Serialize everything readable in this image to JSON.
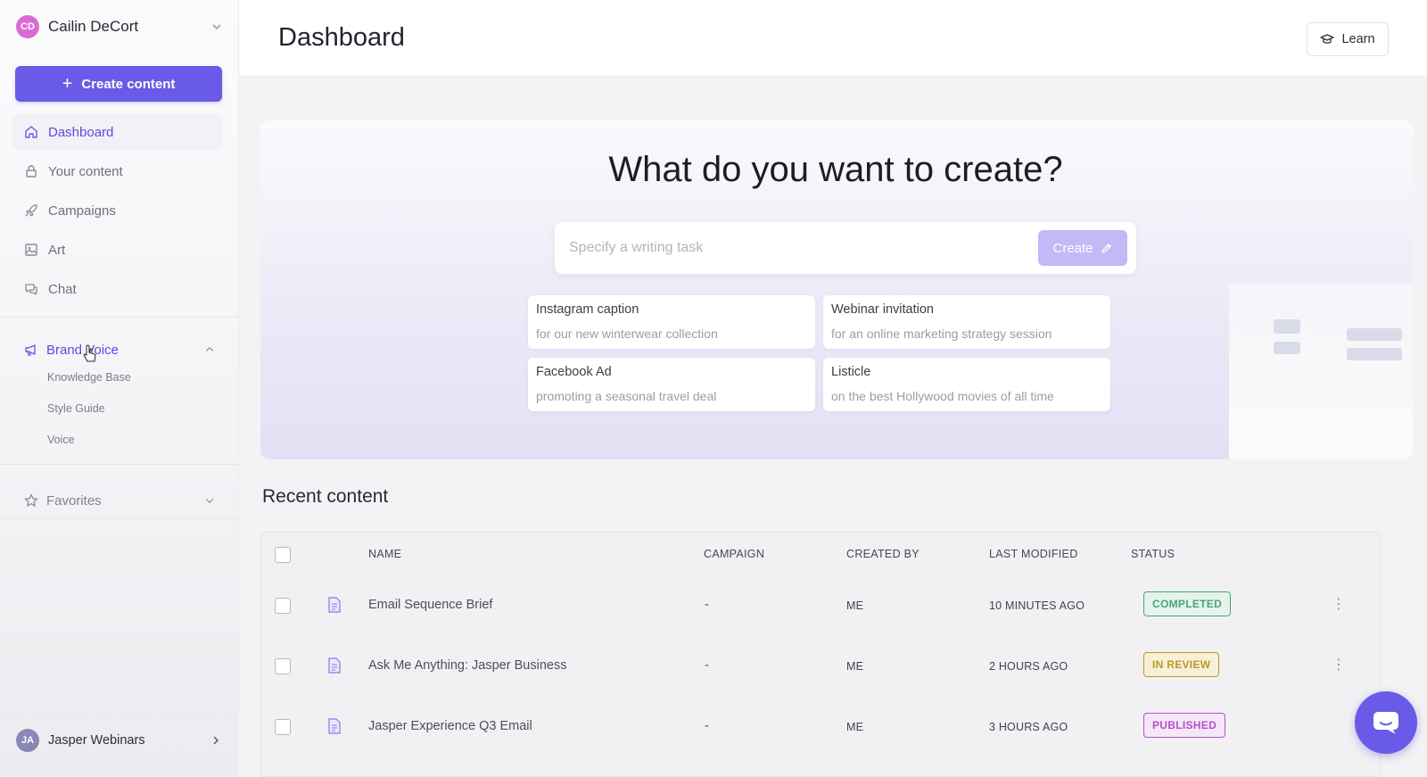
{
  "user": {
    "initials": "CD",
    "name": "Cailin DeCort"
  },
  "sidebar": {
    "create_label": "Create content",
    "nav": [
      {
        "label": "Dashboard",
        "icon": "home-icon",
        "active": true
      },
      {
        "label": "Your content",
        "icon": "lock-icon"
      },
      {
        "label": "Campaigns",
        "icon": "rocket-icon"
      },
      {
        "label": "Art",
        "icon": "image-icon"
      },
      {
        "label": "Chat",
        "icon": "chat-icon"
      }
    ],
    "brand_voice": {
      "label": "Brand Voice",
      "icon": "megaphone-icon",
      "items": [
        "Knowledge Base",
        "Style Guide",
        "Voice"
      ]
    },
    "favorites": {
      "label": "Favorites",
      "icon": "star-icon"
    },
    "workspace": {
      "initials": "JA",
      "name": "Jasper Webinars"
    }
  },
  "header": {
    "title": "Dashboard",
    "learn_label": "Learn"
  },
  "hero": {
    "title": "What do you want to create?",
    "placeholder": "Specify a writing task",
    "create_label": "Create",
    "suggestions": [
      {
        "title": "Instagram caption",
        "subtitle": "for our new winterwear collection"
      },
      {
        "title": "Webinar invitation",
        "subtitle": "for an online marketing strategy session"
      },
      {
        "title": "Facebook Ad",
        "subtitle": "promoting a seasonal travel deal"
      },
      {
        "title": "Listicle",
        "subtitle": "on the best Hollywood movies of all time"
      }
    ]
  },
  "recent": {
    "title": "Recent content",
    "columns": [
      "NAME",
      "CAMPAIGN",
      "CREATED BY",
      "LAST MODIFIED",
      "STATUS"
    ],
    "rows": [
      {
        "name": "Email Sequence Brief",
        "campaign": "-",
        "created_by": "ME",
        "modified": "10 MINUTES AGO",
        "status": "COMPLETED",
        "status_color": "#4aa37a",
        "status_bg": "#e4f4ec"
      },
      {
        "name": "Ask Me Anything: Jasper Business",
        "campaign": "-",
        "created_by": "ME",
        "modified": "2 HOURS AGO",
        "status": "IN REVIEW",
        "status_color": "#b89a2a",
        "status_bg": "#f7f0d6"
      },
      {
        "name": "Jasper Experience Q3 Email",
        "campaign": "-",
        "created_by": "ME",
        "modified": "3 HOURS AGO",
        "status": "PUBLISHED",
        "status_color": "#b253c9",
        "status_bg": "#f5e6f8"
      }
    ]
  },
  "colors": {
    "accent": "#6a5ae8",
    "accent_light": "#c2b9f6"
  }
}
